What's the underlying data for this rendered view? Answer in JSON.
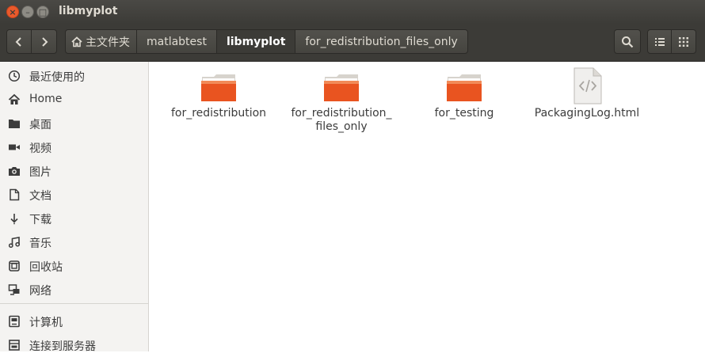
{
  "window": {
    "title": "libmyplot",
    "controls": [
      "close",
      "minimize",
      "maximize"
    ]
  },
  "toolbar": {
    "breadcrumbs": [
      {
        "label": "主文件夹",
        "icon": "home-icon"
      },
      {
        "label": "matlabtest"
      },
      {
        "label": "libmyplot",
        "active": true
      },
      {
        "label": "for_redistribution_files_only"
      }
    ]
  },
  "sidebar": {
    "items": [
      {
        "label": "最近使用的",
        "icon": "recent-icon"
      },
      {
        "label": "Home",
        "icon": "home-icon"
      },
      {
        "label": "桌面",
        "icon": "desktop-folder-icon"
      },
      {
        "label": "视频",
        "icon": "video-icon"
      },
      {
        "label": "图片",
        "icon": "camera-icon"
      },
      {
        "label": "文档",
        "icon": "document-icon"
      },
      {
        "label": "下载",
        "icon": "download-icon"
      },
      {
        "label": "音乐",
        "icon": "music-icon"
      },
      {
        "label": "回收站",
        "icon": "trash-icon"
      },
      {
        "label": "网络",
        "icon": "network-icon"
      },
      {
        "label": "计算机",
        "icon": "computer-icon"
      },
      {
        "label": "连接到服务器",
        "icon": "server-icon"
      }
    ]
  },
  "files": [
    {
      "name": "for_redistribution",
      "type": "folder",
      "icon": "folder-icon"
    },
    {
      "name": "for_redistribution_\nfiles_only",
      "type": "folder",
      "icon": "folder-icon"
    },
    {
      "name": "for_testing",
      "type": "folder",
      "icon": "folder-icon"
    },
    {
      "name": "PackagingLog.html",
      "type": "html",
      "icon": "html-file-icon"
    }
  ],
  "colors": {
    "titlebar": "#3c3b37",
    "close_button": "#e95a2c",
    "folder_orange": "#e95420",
    "sidebar_bg": "#f4f3f1"
  }
}
